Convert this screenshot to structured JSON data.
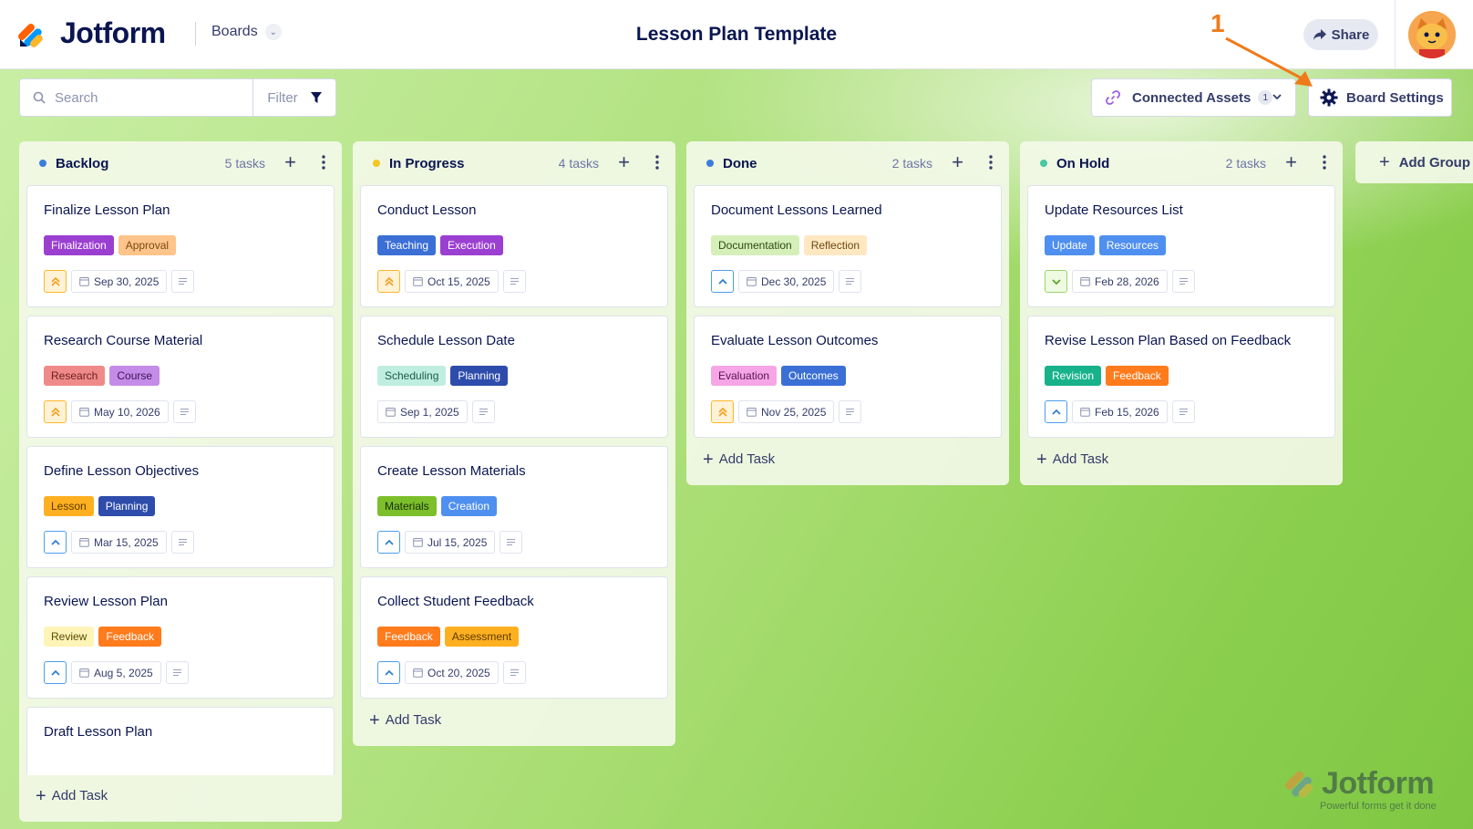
{
  "app": {
    "brand": "Jotform",
    "boards_menu": "Boards",
    "page_title": "Lesson Plan Template",
    "share_label": "Share"
  },
  "toolbar": {
    "search_placeholder": "Search",
    "filter_label": "Filter",
    "connected_assets_label": "Connected Assets",
    "connected_assets_count": "1",
    "board_settings_label": "Board Settings"
  },
  "annotation": {
    "label": "1",
    "color": "#f07a1a"
  },
  "columns": [
    {
      "title": "Backlog",
      "count": "5 tasks",
      "dot": "#3b7ddd",
      "add_task": "Add Task",
      "cards": [
        {
          "title": "Finalize Lesson Plan",
          "tags": [
            {
              "label": "Finalization",
              "bg": "#9b3fd1",
              "fg": "#fff"
            },
            {
              "label": "Approval",
              "bg": "#ffc48a",
              "fg": "#7a4a12"
            }
          ],
          "priority": "highest",
          "date": "Sep 30, 2025"
        },
        {
          "title": "Research Course Material",
          "tags": [
            {
              "label": "Research",
              "bg": "#f08a8a",
              "fg": "#6b1f1f"
            },
            {
              "label": "Course",
              "bg": "#c58be8",
              "fg": "#3d1458"
            }
          ],
          "priority": "highest",
          "date": "May 10, 2026"
        },
        {
          "title": "Define Lesson Objectives",
          "tags": [
            {
              "label": "Lesson",
              "bg": "#ffb020",
              "fg": "#5a3a00"
            },
            {
              "label": "Planning",
              "bg": "#2d4cab",
              "fg": "#fff"
            }
          ],
          "priority": "up",
          "date": "Mar 15, 2025"
        },
        {
          "title": "Review Lesson Plan",
          "tags": [
            {
              "label": "Review",
              "bg": "#fff4b8",
              "fg": "#5a4a00"
            },
            {
              "label": "Feedback",
              "bg": "#ff7b1c",
              "fg": "#fff"
            }
          ],
          "priority": "up",
          "date": "Aug 5, 2025"
        },
        {
          "title": "Draft Lesson Plan",
          "tags": [],
          "priority": "",
          "date": ""
        }
      ]
    },
    {
      "title": "In Progress",
      "count": "4 tasks",
      "dot": "#f3c623",
      "add_task": "Add Task",
      "cards": [
        {
          "title": "Conduct Lesson",
          "tags": [
            {
              "label": "Teaching",
              "bg": "#3b6fd6",
              "fg": "#fff"
            },
            {
              "label": "Execution",
              "bg": "#9b3fd1",
              "fg": "#fff"
            }
          ],
          "priority": "highest",
          "date": "Oct 15, 2025"
        },
        {
          "title": "Schedule Lesson Date",
          "tags": [
            {
              "label": "Scheduling",
              "bg": "#bfeee0",
              "fg": "#1c5a48"
            },
            {
              "label": "Planning",
              "bg": "#2d4cab",
              "fg": "#fff"
            }
          ],
          "priority": "",
          "date": "Sep 1, 2025"
        },
        {
          "title": "Create Lesson Materials",
          "tags": [
            {
              "label": "Materials",
              "bg": "#7cbf2a",
              "fg": "#17300a"
            },
            {
              "label": "Creation",
              "bg": "#4f8ff0",
              "fg": "#fff"
            }
          ],
          "priority": "up",
          "date": "Jul 15, 2025"
        },
        {
          "title": "Collect Student Feedback",
          "tags": [
            {
              "label": "Feedback",
              "bg": "#ff7b1c",
              "fg": "#fff"
            },
            {
              "label": "Assessment",
              "bg": "#ffb020",
              "fg": "#5a3a00"
            }
          ],
          "priority": "up",
          "date": "Oct 20, 2025"
        }
      ]
    },
    {
      "title": "Done",
      "count": "2 tasks",
      "dot": "#3b7ddd",
      "add_task": "Add Task",
      "cards": [
        {
          "title": "Document Lessons Learned",
          "tags": [
            {
              "label": "Documentation",
              "bg": "#d5efb8",
              "fg": "#2c4a12"
            },
            {
              "label": "Reflection",
              "bg": "#ffe7c2",
              "fg": "#6a4a12"
            }
          ],
          "priority": "up",
          "date": "Dec 30, 2025"
        },
        {
          "title": "Evaluate Lesson Outcomes",
          "tags": [
            {
              "label": "Evaluation",
              "bg": "#f6a5e6",
              "fg": "#5a1450"
            },
            {
              "label": "Outcomes",
              "bg": "#3b6fd6",
              "fg": "#fff"
            }
          ],
          "priority": "highest",
          "date": "Nov 25, 2025"
        }
      ]
    },
    {
      "title": "On Hold",
      "count": "2 tasks",
      "dot": "#49c8a4",
      "add_task": "Add Task",
      "cards": [
        {
          "title": "Update Resources List",
          "tags": [
            {
              "label": "Update",
              "bg": "#4f8ff0",
              "fg": "#fff"
            },
            {
              "label": "Resources",
              "bg": "#4f8ff0",
              "fg": "#fff"
            }
          ],
          "priority": "down",
          "date": "Feb 28, 2026"
        },
        {
          "title": "Revise Lesson Plan Based on Feedback",
          "tags": [
            {
              "label": "Revision",
              "bg": "#18b28a",
              "fg": "#fff"
            },
            {
              "label": "Feedback",
              "bg": "#ff7b1c",
              "fg": "#fff"
            }
          ],
          "priority": "up",
          "date": "Feb 15, 2026"
        }
      ]
    }
  ],
  "add_group_label": "Add Group",
  "watermark": {
    "brand": "Jotform",
    "tagline": "Powerful forms get it done"
  },
  "colors": {
    "accent_orange": "#ff6100",
    "navy": "#0a1551",
    "priority_high": "#ffb629",
    "priority_up": "#4d9ded",
    "priority_down": "#78c73a"
  }
}
